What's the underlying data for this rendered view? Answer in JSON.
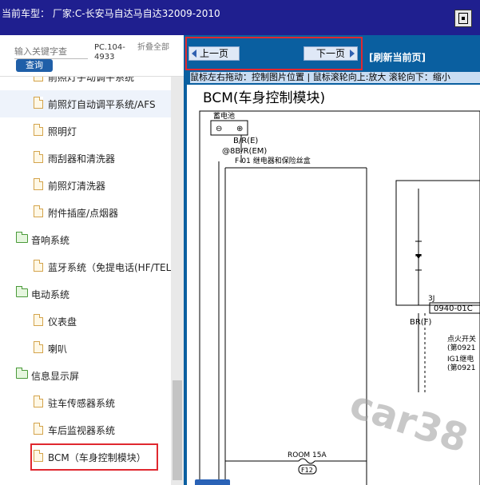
{
  "window": {
    "title": "当前车型： 厂家:C-长安马自达马自达32009-2010"
  },
  "search": {
    "placeholder": "输入关键字查",
    "button_label": "查询",
    "pc_label": "PC.104-4933",
    "fold_label": "折叠全部"
  },
  "tree": {
    "items": [
      {
        "label": "前照灯手动调平系统",
        "type": "doc"
      },
      {
        "label": "前照灯自动调平系统/AFS",
        "type": "doc"
      },
      {
        "label": "照明灯",
        "type": "doc"
      },
      {
        "label": "雨刮器和清洗器",
        "type": "doc"
      },
      {
        "label": "前照灯清洗器",
        "type": "doc"
      },
      {
        "label": "附件插座/点烟器",
        "type": "doc"
      },
      {
        "label": "音响系统",
        "type": "folder"
      },
      {
        "label": "蓝牙系统（免提电话(HF/TEL",
        "type": "doc"
      },
      {
        "label": "电动系统",
        "type": "folder"
      },
      {
        "label": "仪表盘",
        "type": "doc"
      },
      {
        "label": "喇叭",
        "type": "doc"
      },
      {
        "label": "信息显示屏",
        "type": "folder"
      },
      {
        "label": "驻车传感器系统",
        "type": "doc"
      },
      {
        "label": "车后监视器系统",
        "type": "doc"
      },
      {
        "label": "BCM（车身控制模块）",
        "type": "doc"
      }
    ]
  },
  "nav": {
    "prev_label": "上一页",
    "next_label": "下一页",
    "refresh_label": "[刷新当前页]",
    "hint": "鼠标左右拖动：控制图片位置 | 鼠标滚轮向上:放大  滚轮向下：缩小"
  },
  "diagram": {
    "title": "BCM(车身控制模块)",
    "battery_label": "蓄电池",
    "minus": "⊖",
    "plus": "⊕",
    "wire1": "B/R(E)",
    "wire2": "@8B/R(EM)",
    "relay_box": "F-01 继电器和保险丝盒",
    "connector_3j": "3J",
    "connector_code": "0940-01C",
    "wire3": "BR(F)",
    "ignition1": "点火开关",
    "ref1": "(第0921",
    "ign_relay": "IG1继电",
    "ref2": "(第0921",
    "fuse": "ROOM 15A",
    "fuse_id": "F12",
    "watermark": "car38"
  },
  "colors": {
    "titlebar": "#1f1f8f",
    "nav_blue": "#0a5fa0",
    "highlight_red": "#e0282f",
    "search_blue": "#1f5fa8"
  },
  "icons": {
    "window_button": "restore-icon",
    "prev": "arrow-left-icon",
    "next": "arrow-right-icon",
    "doc": "document-icon",
    "folder": "folder-icon"
  }
}
